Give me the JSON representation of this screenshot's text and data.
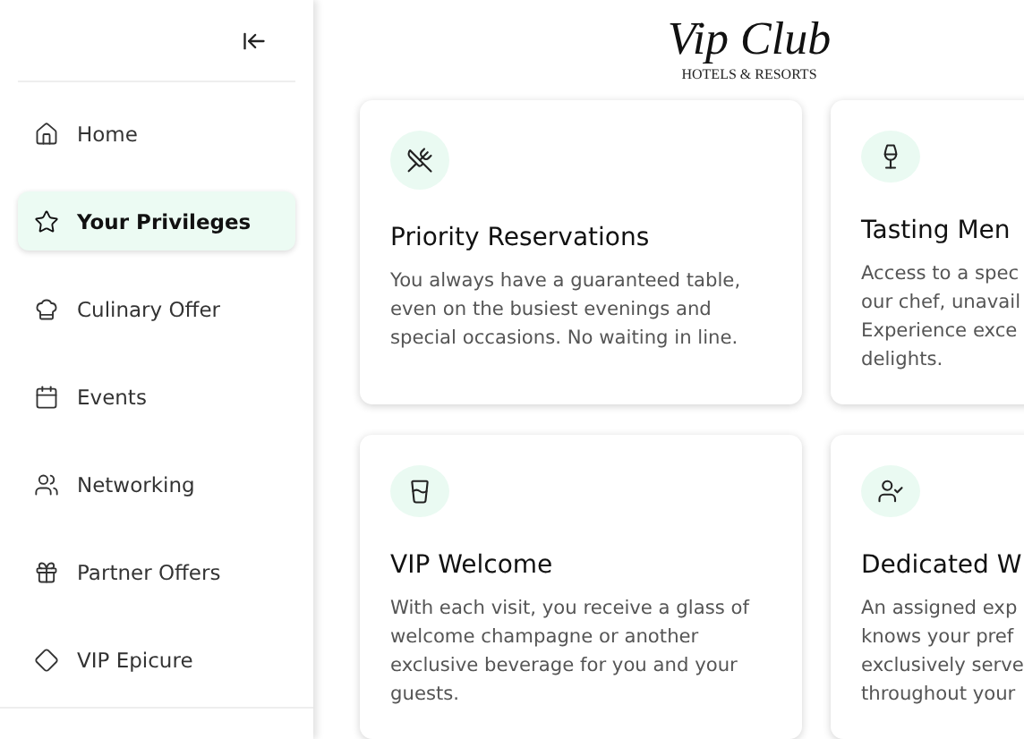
{
  "sidebar": {
    "items": [
      {
        "label": "Home",
        "selected": false
      },
      {
        "label": "Your Privileges",
        "selected": true
      },
      {
        "label": "Culinary Offer",
        "selected": false
      },
      {
        "label": "Events",
        "selected": false
      },
      {
        "label": "Networking",
        "selected": false
      },
      {
        "label": "Partner Offers",
        "selected": false
      },
      {
        "label": "VIP Epicure",
        "selected": false
      }
    ]
  },
  "logo": {
    "name": "Vip Club",
    "tagline": "HOTELS & RESORTS"
  },
  "cards": [
    {
      "title": "Priority Reservations",
      "body_lines": [
        "You always have a guaranteed table,",
        "even on the busiest evenings and",
        "special occasions. No waiting in line."
      ]
    },
    {
      "title": "Tasting Men",
      "body_lines": [
        "Access to a spec",
        "our chef, unavail",
        "Experience exce",
        "delights."
      ]
    },
    {
      "title": "VIP Welcome",
      "body_lines": [
        "With each visit, you receive a glass of",
        "welcome champagne or another",
        "exclusive beverage for you and your",
        "guests."
      ]
    },
    {
      "title": "Dedicated W",
      "body_lines": [
        "An assigned exp",
        "knows your pref",
        "exclusively serve",
        "throughout your"
      ]
    }
  ]
}
